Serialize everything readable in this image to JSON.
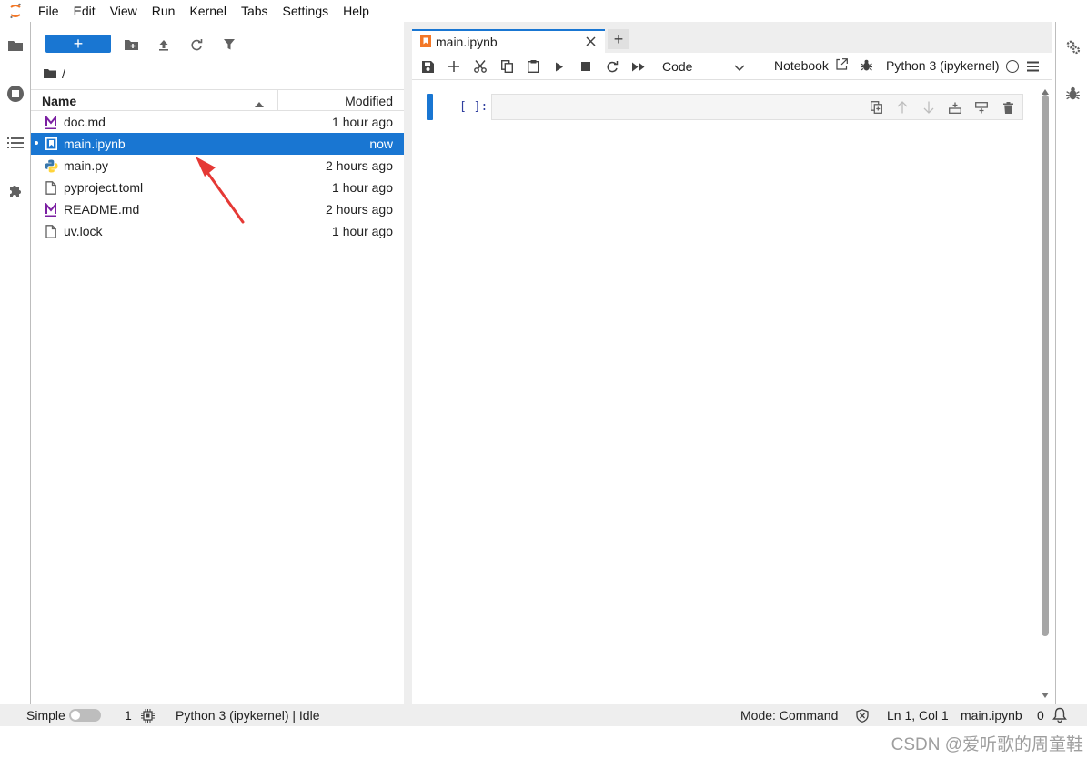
{
  "menubar": {
    "items": [
      "File",
      "Edit",
      "View",
      "Run",
      "Kernel",
      "Tabs",
      "Settings",
      "Help"
    ]
  },
  "filebrowser": {
    "breadcrumb": "/",
    "header": {
      "name": "Name",
      "modified": "Modified"
    },
    "files": [
      {
        "name": "doc.md",
        "modified": "1 hour ago",
        "icon": "markdown-icon"
      },
      {
        "name": "main.ipynb",
        "modified": "now",
        "icon": "notebook-icon",
        "selected": true
      },
      {
        "name": "main.py",
        "modified": "2 hours ago",
        "icon": "python-icon"
      },
      {
        "name": "pyproject.toml",
        "modified": "1 hour ago",
        "icon": "file-icon"
      },
      {
        "name": "README.md",
        "modified": "2 hours ago",
        "icon": "markdown-icon"
      },
      {
        "name": "uv.lock",
        "modified": "1 hour ago",
        "icon": "file-icon"
      }
    ]
  },
  "tabs": {
    "active_label": "main.ipynb"
  },
  "notebook_toolbar": {
    "cell_type": "Code",
    "notebook_label": "Notebook",
    "kernel_name": "Python 3 (ipykernel)"
  },
  "cell": {
    "prompt": "[ ]:"
  },
  "statusbar": {
    "mode_label": "Simple",
    "terminals_count": "1",
    "kernel_status": "Python 3 (ipykernel) | Idle",
    "mode": "Mode: Command",
    "cursor": "Ln 1, Col 1",
    "filename": "main.ipynb",
    "notifications": "0"
  },
  "watermark": "CSDN @爱听歌的周童鞋",
  "colors": {
    "accent": "#1976d2",
    "annotation": "#e53935"
  }
}
